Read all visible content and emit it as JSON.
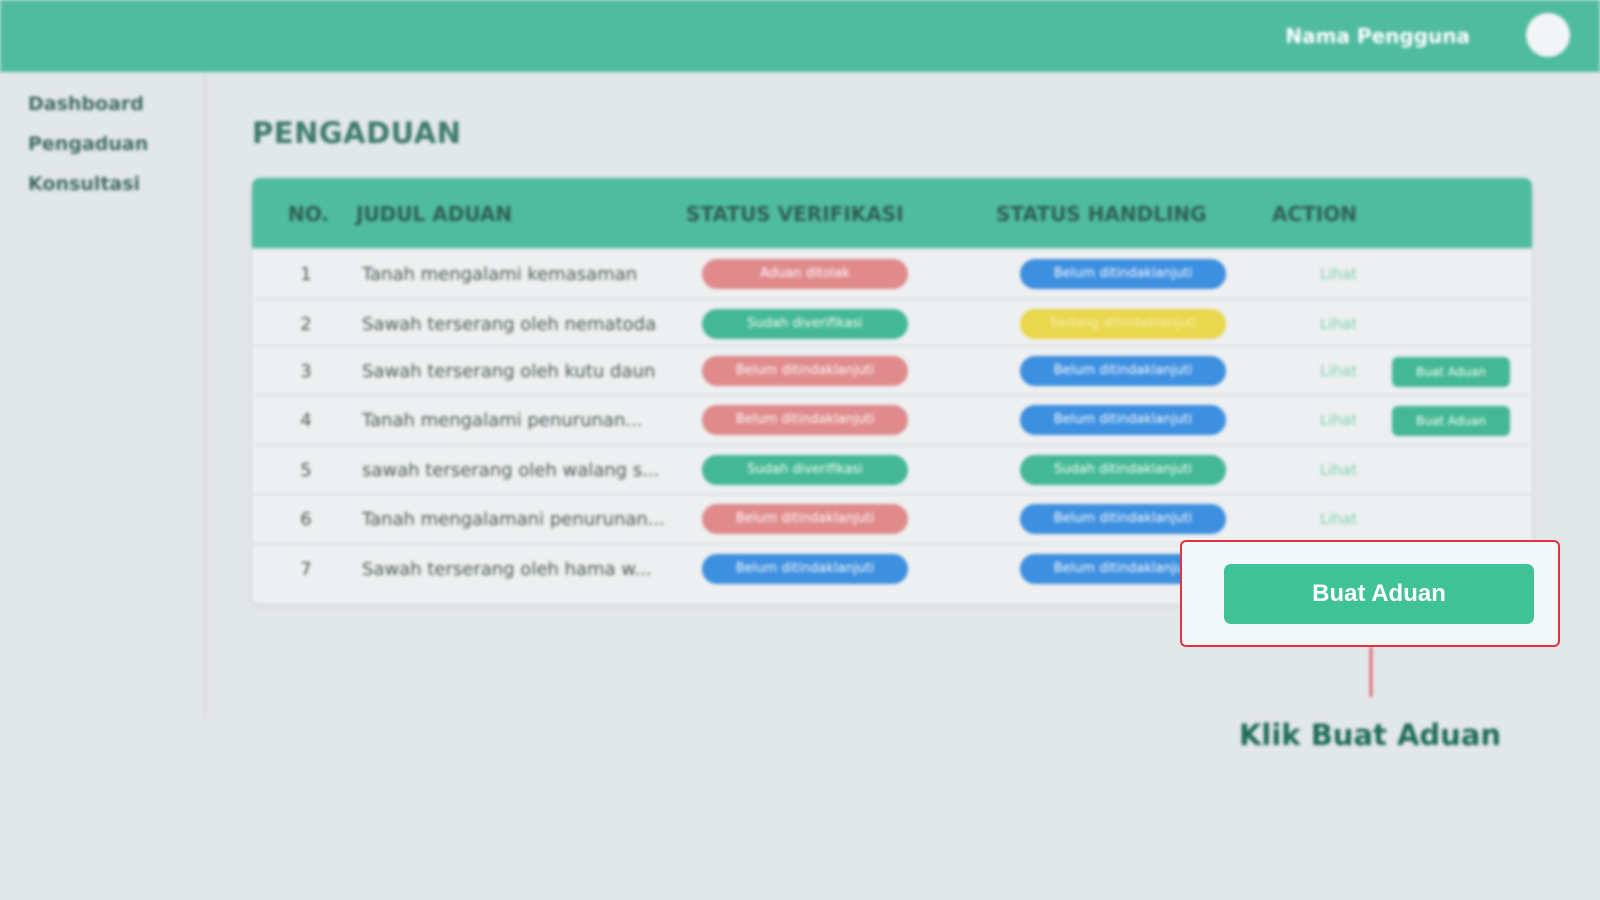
{
  "header": {
    "user_name": "Nama Pengguna",
    "brand_color": "#4fbb9f"
  },
  "sidebar": {
    "items": [
      {
        "label": "Dashboard"
      },
      {
        "label": "Pengaduan"
      },
      {
        "label": "Konsultasi"
      }
    ]
  },
  "page": {
    "title": "PENGADUAN"
  },
  "table": {
    "columns": [
      "NO.",
      "JUDUL ADUAN",
      "STATUS VERIFIKASI",
      "STATUS HANDLING",
      "ACTION"
    ],
    "rows": [
      {
        "no": "1",
        "title": "Tanah mengalami kemasaman",
        "verification": "Aduan ditolak",
        "verification_color": "red",
        "handling": "Belum ditindaklanjuti",
        "handling_color": "blue",
        "action": "Lihat",
        "extra": ""
      },
      {
        "no": "2",
        "title": "Sawah terserang oleh nematoda",
        "verification": "Sudah diverifikasi",
        "verification_color": "green",
        "handling": "Sedang ditindaklanjuti",
        "handling_color": "yellow",
        "action": "Lihat",
        "extra": ""
      },
      {
        "no": "3",
        "title": "Sawah terserang oleh kutu daun",
        "verification": "Belum ditindaklanjuti",
        "verification_color": "red",
        "handling": "Belum ditindaklanjuti",
        "handling_color": "blue",
        "action": "Lihat",
        "extra": "Buat Aduan"
      },
      {
        "no": "4",
        "title": "Tanah mengalami penurunan...",
        "verification": "Belum ditindaklanjuti",
        "verification_color": "red",
        "handling": "Belum ditindaklanjuti",
        "handling_color": "blue",
        "action": "Lihat",
        "extra": "Buat Aduan"
      },
      {
        "no": "5",
        "title": "sawah terserang oleh walang s...",
        "verification": "Sudah diverifikasi",
        "verification_color": "green",
        "handling": "Sudah ditindaklanjuti",
        "handling_color": "green",
        "action": "Lihat",
        "extra": ""
      },
      {
        "no": "6",
        "title": "Tanah mengalamani penurunan...",
        "verification": "Belum ditindaklanjuti",
        "verification_color": "red",
        "handling": "Belum ditindaklanjuti",
        "handling_color": "blue",
        "action": "Lihat",
        "extra": ""
      },
      {
        "no": "7",
        "title": "Sawah terserang oleh hama w...",
        "verification": "Belum ditindaklanjuti",
        "verification_color": "blue",
        "handling": "Belum ditindaklanjuti",
        "handling_color": "blue",
        "action": "",
        "extra": ""
      }
    ]
  },
  "callout": {
    "button_label": "Buat Aduan",
    "instruction": "Klik Buat Aduan",
    "highlight_color": "#e2323c"
  }
}
